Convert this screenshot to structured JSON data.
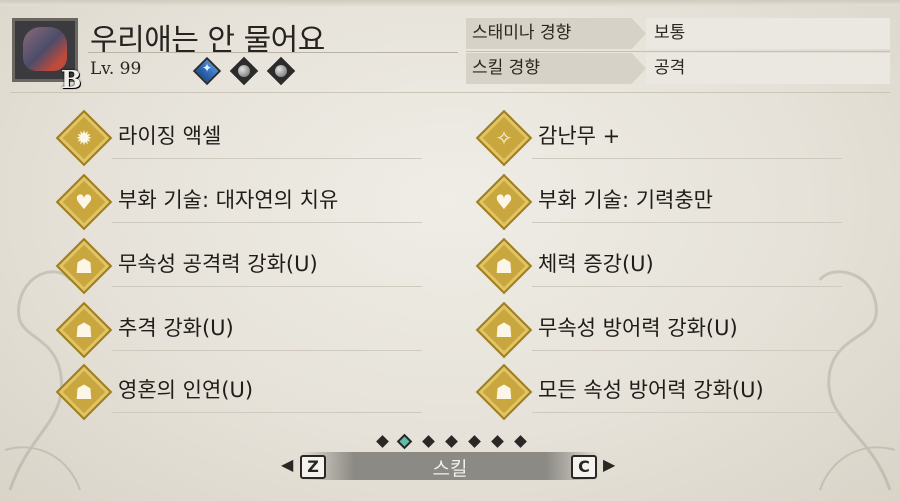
{
  "hunter": {
    "name": "우리애는 안 물어요",
    "rank_letter": "B",
    "level": "Lv. 99",
    "slots": [
      "decoration",
      "empty",
      "empty"
    ]
  },
  "tendencies": [
    {
      "key": "스태미나 경향",
      "value": "보통"
    },
    {
      "key": "스킬 경향",
      "value": "공격"
    }
  ],
  "skills": [
    {
      "label": "라이징 액셀",
      "icon": "sun-burst-icon"
    },
    {
      "label": "감난무 +",
      "icon": "sparkle-slash-icon"
    },
    {
      "label": "부화 기술: 대자연의 치유",
      "icon": "heart-icon"
    },
    {
      "label": "부화 기술: 기력충만",
      "icon": "heart-icon"
    },
    {
      "label": "무속성 공격력 강화(U)",
      "icon": "flex-figure-icon"
    },
    {
      "label": "체력 증강(U)",
      "icon": "flex-figure-icon"
    },
    {
      "label": "추격 강화(U)",
      "icon": "flex-figure-icon"
    },
    {
      "label": "무속성 방어력 강화(U)",
      "icon": "flex-figure-icon"
    },
    {
      "label": "영혼의 인연(U)",
      "icon": "flex-figure-icon"
    },
    {
      "label": "모든 속성 방어력 강화(U)",
      "icon": "flex-figure-icon"
    }
  ],
  "footer": {
    "tab_label": "스킬",
    "prev_key": "Z",
    "next_key": "C",
    "page_count": 7,
    "active_page": 1
  },
  "colors": {
    "badge_gold": "#c9a73e",
    "active_dot": "#5cc0a8"
  }
}
